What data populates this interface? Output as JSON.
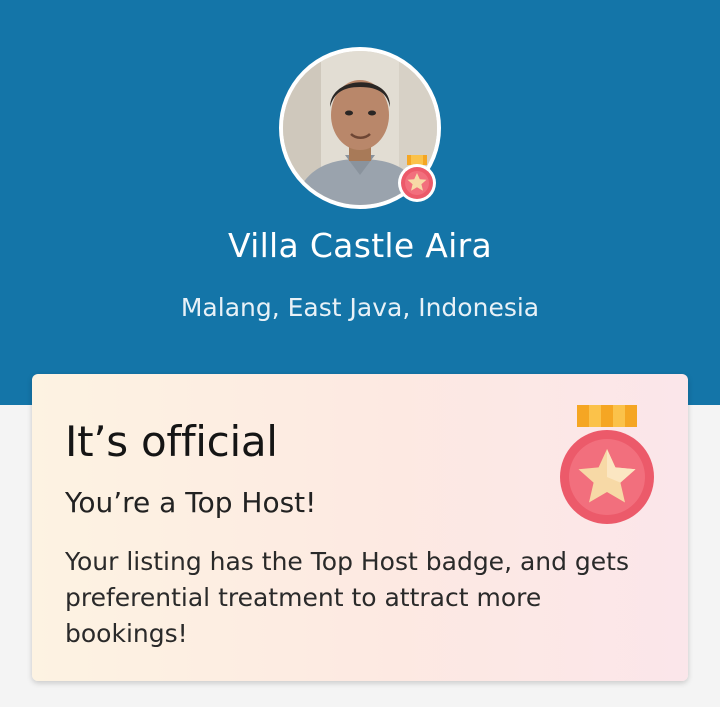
{
  "host": {
    "name": "Villa Castle Aira",
    "location": "Malang, East Java, Indonesia",
    "avatar_icon": "host-avatar-photo",
    "badge_icon": "top-host-medal-icon"
  },
  "card": {
    "title": "It’s official",
    "subtitle": "You’re a Top Host!",
    "body": "Your listing has the Top Host badge, and gets preferential treatment to attract more bookings!",
    "medal_icon": "top-host-medal-icon"
  },
  "colors": {
    "header_bg": "#1475a8",
    "medal_red": "#ec5a6a",
    "medal_ribbon": "#f5a623",
    "star": "#f7d9a6"
  }
}
